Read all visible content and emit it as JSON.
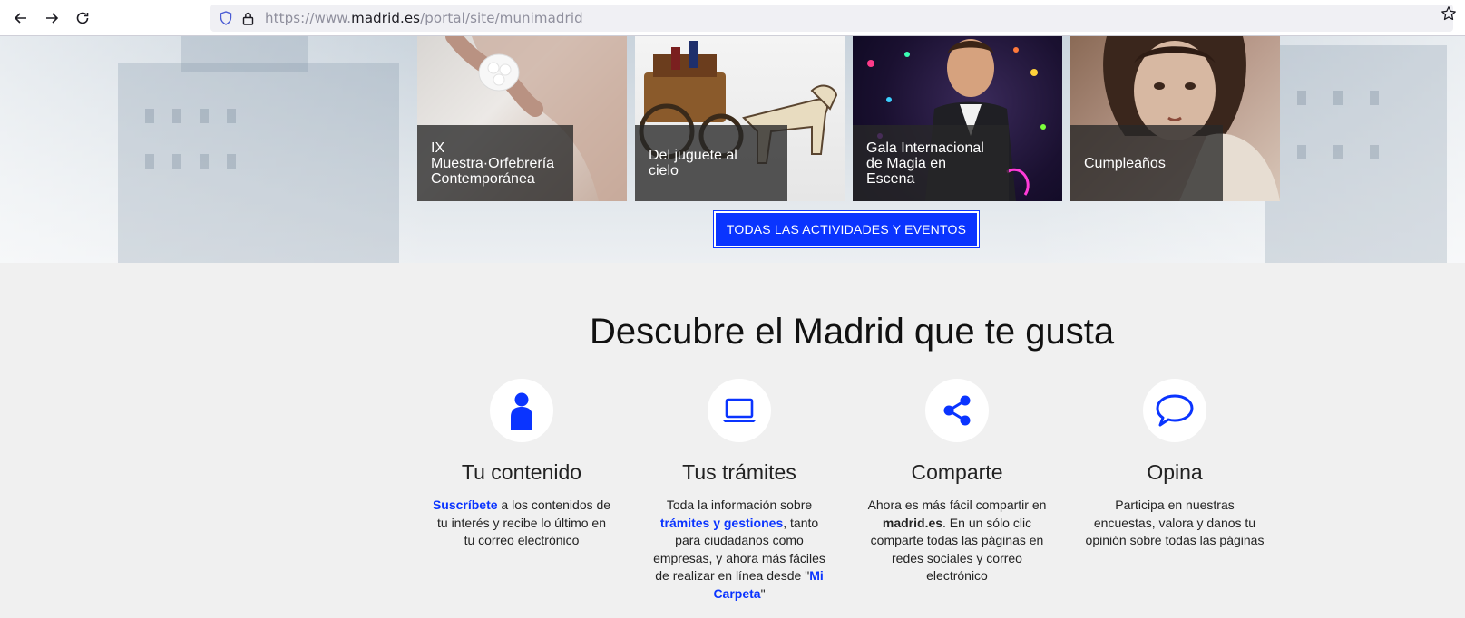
{
  "browser": {
    "url_prefix": "https://www.",
    "url_host": "madrid.es",
    "url_path": "/portal/site/munimadrid"
  },
  "events": {
    "cards": [
      {
        "label_lines": [
          "IX",
          "Muestra·Orfebrería",
          "Contemporánea"
        ]
      },
      {
        "label_lines": [
          "Del juguete al",
          "cielo"
        ]
      },
      {
        "label_lines": [
          "Gala Internacional",
          "de Magia en",
          "Escena"
        ]
      },
      {
        "label_lines": [
          "Cumpleaños"
        ]
      }
    ],
    "cta_label": "TODAS LAS ACTIVIDADES Y EVENTOS"
  },
  "discover": {
    "title": "Descubre el Madrid que te gusta",
    "features": [
      {
        "icon": "user-icon",
        "title": "Tu contenido",
        "link": "Suscríbete",
        "text": " a los contenidos de tu interés y recibe lo último en tu correo electrónico"
      },
      {
        "icon": "laptop-icon",
        "title": "Tus trámites",
        "text_before": "Toda la información sobre ",
        "link": "trámites y gestiones",
        "text_middle": ", tanto para ciudadanos como empresas, y ahora más fáciles de realizar en línea desde \"",
        "link2": "Mi Carpeta",
        "text_after": "\""
      },
      {
        "icon": "share-icon",
        "title": "Comparte",
        "text_before": "Ahora es más fácil compartir en ",
        "strong": "madrid.es",
        "text_after": ". En un sólo clic comparte todas las páginas en redes sociales y correo electrónico"
      },
      {
        "icon": "speech-bubble-icon",
        "title": "Opina",
        "text": "Participa en nuestras encuestas, valora y danos tu opinión sobre todas las páginas"
      }
    ]
  },
  "colors": {
    "accent": "#0a34ff",
    "section_bg": "#f0f0f0",
    "caption_bg": "#282828"
  }
}
